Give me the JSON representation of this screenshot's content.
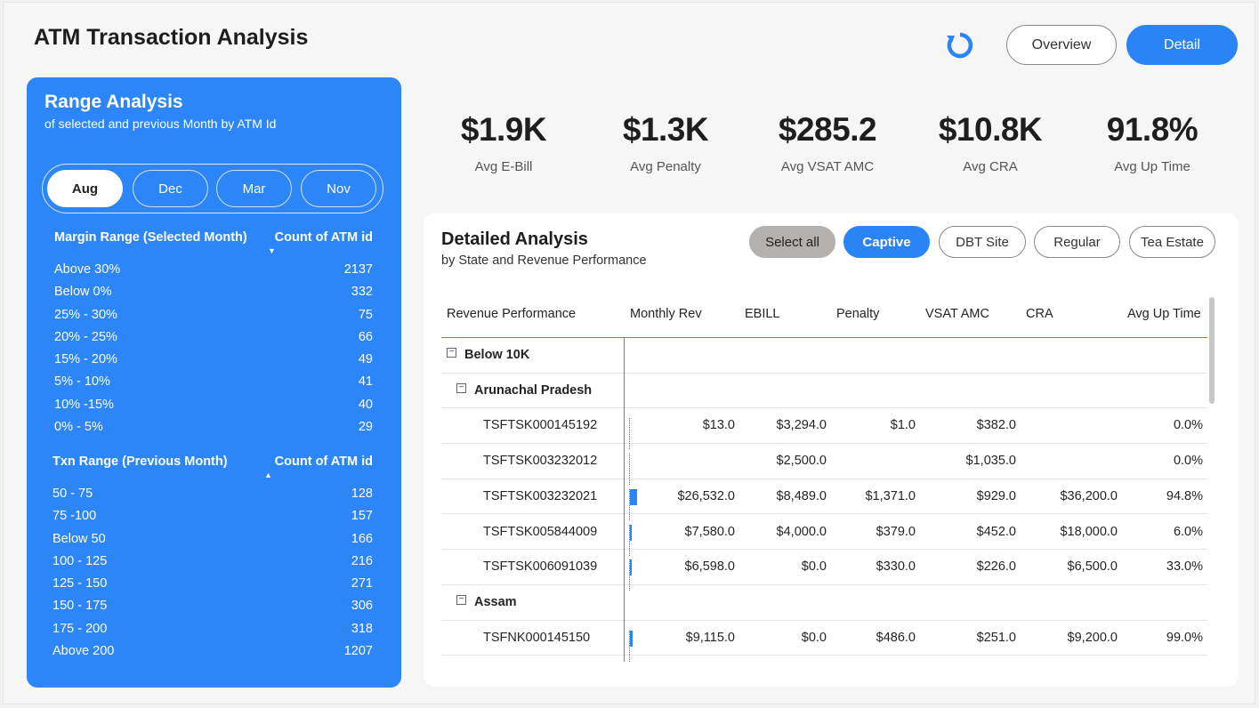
{
  "app_title": "ATM Transaction Analysis",
  "header": {
    "refresh_icon": "refresh-icon",
    "overview_label": "Overview",
    "detail_label": "Detail"
  },
  "range_panel": {
    "title": "Range Analysis",
    "subtitle": "of selected and previous Month by ATM Id",
    "months": [
      "Aug",
      "Dec",
      "Mar",
      "Nov"
    ],
    "selected_month": "Aug",
    "margin_table": {
      "col1": "Margin Range (Selected Month)",
      "col2": "Count of ATM id",
      "rows": [
        {
          "label": "Above 30%",
          "value": "2137"
        },
        {
          "label": "Below 0%",
          "value": "332"
        },
        {
          "label": "25% - 30%",
          "value": "75"
        },
        {
          "label": "20% - 25%",
          "value": "66"
        },
        {
          "label": "15% - 20%",
          "value": "49"
        },
        {
          "label": "5% - 10%",
          "value": "41"
        },
        {
          "label": "10% -15%",
          "value": "40"
        },
        {
          "label": "0% - 5%",
          "value": "29"
        }
      ]
    },
    "txn_table": {
      "col1": "Txn Range (Previous Month)",
      "col2": "Count of ATM id",
      "rows": [
        {
          "label": "50 - 75",
          "value": "128"
        },
        {
          "label": "75 -100",
          "value": "157"
        },
        {
          "label": "Below 50",
          "value": "166"
        },
        {
          "label": "100 - 125",
          "value": "216"
        },
        {
          "label": "125 - 150",
          "value": "271"
        },
        {
          "label": "150 - 175",
          "value": "306"
        },
        {
          "label": "175 - 200",
          "value": "318"
        },
        {
          "label": "Above 200",
          "value": "1207"
        }
      ]
    }
  },
  "kpis": [
    {
      "value": "$1.9K",
      "label": "Avg E-Bill"
    },
    {
      "value": "$1.3K",
      "label": "Avg Penalty"
    },
    {
      "value": "$285.2",
      "label": "Avg VSAT AMC"
    },
    {
      "value": "$10.8K",
      "label": "Avg CRA"
    },
    {
      "value": "91.8%",
      "label": "Avg Up Time"
    }
  ],
  "detail": {
    "title": "Detailed Analysis",
    "subtitle": "by State and Revenue Performance",
    "filters": [
      "Select all",
      "Captive",
      "DBT Site",
      "Regular",
      "Tea Estate"
    ],
    "active_filter": "Captive",
    "columns": [
      "Revenue Performance",
      "Monthly Rev",
      "EBILL",
      "Penalty",
      "VSAT AMC",
      "CRA",
      "Avg Up Time"
    ],
    "rows": [
      {
        "type": "group",
        "label": "Below 10K"
      },
      {
        "type": "subgroup",
        "label": "Arunachal Pradesh"
      },
      {
        "type": "item",
        "label": "TSFTSK000145192",
        "monthly_rev": "$13.0",
        "monthly_rev_share": 0.0,
        "ebill": "$3,294.0",
        "penalty": "$1.0",
        "vsat": "$382.0",
        "cra": "",
        "uptime": "0.0%"
      },
      {
        "type": "item",
        "label": "TSFTSK003232012",
        "monthly_rev": "",
        "monthly_rev_share": 0.0,
        "ebill": "$2,500.0",
        "penalty": "",
        "vsat": "$1,035.0",
        "cra": "",
        "uptime": "0.0%"
      },
      {
        "type": "item",
        "label": "TSFTSK003232021",
        "monthly_rev": "$26,532.0",
        "monthly_rev_share": 1.0,
        "ebill": "$8,489.0",
        "penalty": "$1,371.0",
        "vsat": "$929.0",
        "cra": "$36,200.0",
        "uptime": "94.8%"
      },
      {
        "type": "item",
        "label": "TSFTSK005844009",
        "monthly_rev": "$7,580.0",
        "monthly_rev_share": 0.29,
        "ebill": "$4,000.0",
        "penalty": "$379.0",
        "vsat": "$452.0",
        "cra": "$18,000.0",
        "uptime": "6.0%"
      },
      {
        "type": "item",
        "label": "TSFTSK006091039",
        "monthly_rev": "$6,598.0",
        "monthly_rev_share": 0.25,
        "ebill": "$0.0",
        "penalty": "$330.0",
        "vsat": "$226.0",
        "cra": "$6,500.0",
        "uptime": "33.0%"
      },
      {
        "type": "subgroup",
        "label": "Assam"
      },
      {
        "type": "item",
        "label": "TSFNK000145150",
        "monthly_rev": "$9,115.0",
        "monthly_rev_share": 0.34,
        "ebill": "$0.0",
        "penalty": "$486.0",
        "vsat": "$251.0",
        "cra": "$9,200.0",
        "uptime": "99.0%"
      }
    ]
  },
  "colors": {
    "accent": "#2b84f6",
    "panel_blue": "#2d86f7",
    "grid_line": "#2b9ac9"
  }
}
